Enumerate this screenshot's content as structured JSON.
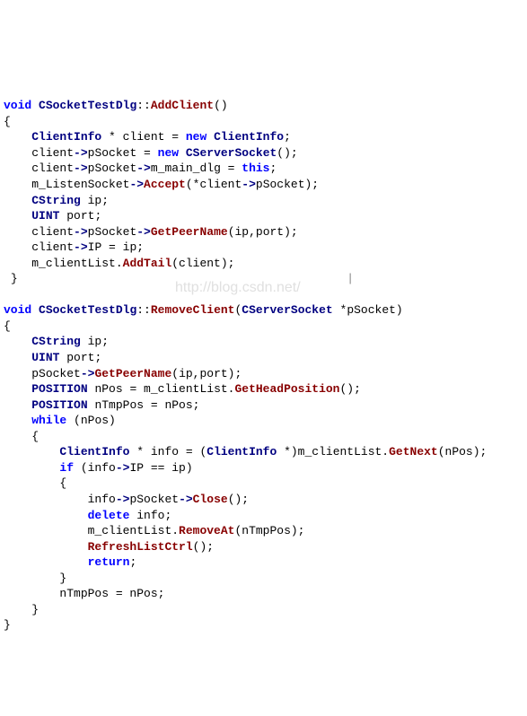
{
  "watermark": "http://blog.csdn.net/",
  "func1": {
    "sig_void": "void",
    "sig_class": "CSocketTestDlg",
    "sig_scope": "::",
    "sig_name": "AddClient",
    "sig_parens": "()",
    "l_open": "{",
    "l1_a": "ClientInfo",
    "l1_b": " * client = ",
    "l1_c": "new",
    "l1_d": " ",
    "l1_e": "ClientInfo",
    "l1_f": ";",
    "l2_a": "client",
    "l2_b": "->",
    "l2_c": "pSocket = ",
    "l2_d": "new",
    "l2_e": " ",
    "l2_f": "CServerSocket",
    "l2_g": "();",
    "l3_a": "client",
    "l3_b": "->",
    "l3_c": "pSocket",
    "l3_d": "->",
    "l3_e": "m_main_dlg = ",
    "l3_f": "this",
    "l3_g": ";",
    "l4_a": "m_ListenSocket",
    "l4_b": "->",
    "l4_c": "Accept",
    "l4_d": "(*client",
    "l4_e": "->",
    "l4_f": "pSocket);",
    "l5_a": "CString",
    "l5_b": " ip;",
    "l6_a": "UINT",
    "l6_b": " port;",
    "l7_a": "client",
    "l7_b": "->",
    "l7_c": "pSocket",
    "l7_d": "->",
    "l7_e": "GetPeerName",
    "l7_f": "(ip,port);",
    "l8_a": "client",
    "l8_b": "->",
    "l8_c": "IP = ip;",
    "l9_a": "m_clientList.",
    "l9_b": "AddTail",
    "l9_c": "(client);",
    "l_close": "}",
    "cursor": "|"
  },
  "func2": {
    "sig_void": "void",
    "sig_class": "CSocketTestDlg",
    "sig_scope": "::",
    "sig_name": "RemoveClient",
    "sig_p1": "(",
    "sig_argtype": "CServerSocket",
    "sig_argrest": " *pSocket)",
    "l_open": "{",
    "l1_a": "CString",
    "l1_b": " ip;",
    "l2_a": "UINT",
    "l2_b": " port;",
    "l3_a": "pSocket",
    "l3_b": "->",
    "l3_c": "GetPeerName",
    "l3_d": "(ip,port);",
    "l4_a": "POSITION",
    "l4_b": " nPos = m_clientList.",
    "l4_c": "GetHeadPosition",
    "l4_d": "();",
    "l5_a": "POSITION",
    "l5_b": " nTmpPos = nPos;",
    "l6_a": "while",
    "l6_b": " (nPos)",
    "l7": "{",
    "l8_a": "ClientInfo",
    "l8_b": " * info = (",
    "l8_c": "ClientInfo",
    "l8_d": " *)m_clientList.",
    "l8_e": "GetNext",
    "l8_f": "(nPos);",
    "l9_a": "if",
    "l9_b": " (info",
    "l9_c": "->",
    "l9_d": "IP == ip)",
    "l10": "{",
    "l11_a": "info",
    "l11_b": "->",
    "l11_c": "pSocket",
    "l11_d": "->",
    "l11_e": "Close",
    "l11_f": "();",
    "l12_a": "delete",
    "l12_b": " info;",
    "l13_a": "m_clientList.",
    "l13_b": "RemoveAt",
    "l13_c": "(nTmpPos);",
    "l14_a": "RefreshListCtrl",
    "l14_b": "();",
    "l15_a": "return",
    "l15_b": ";",
    "l16": "}",
    "l17": "nTmpPos = nPos;",
    "l18": "}",
    "l_close": "}"
  }
}
